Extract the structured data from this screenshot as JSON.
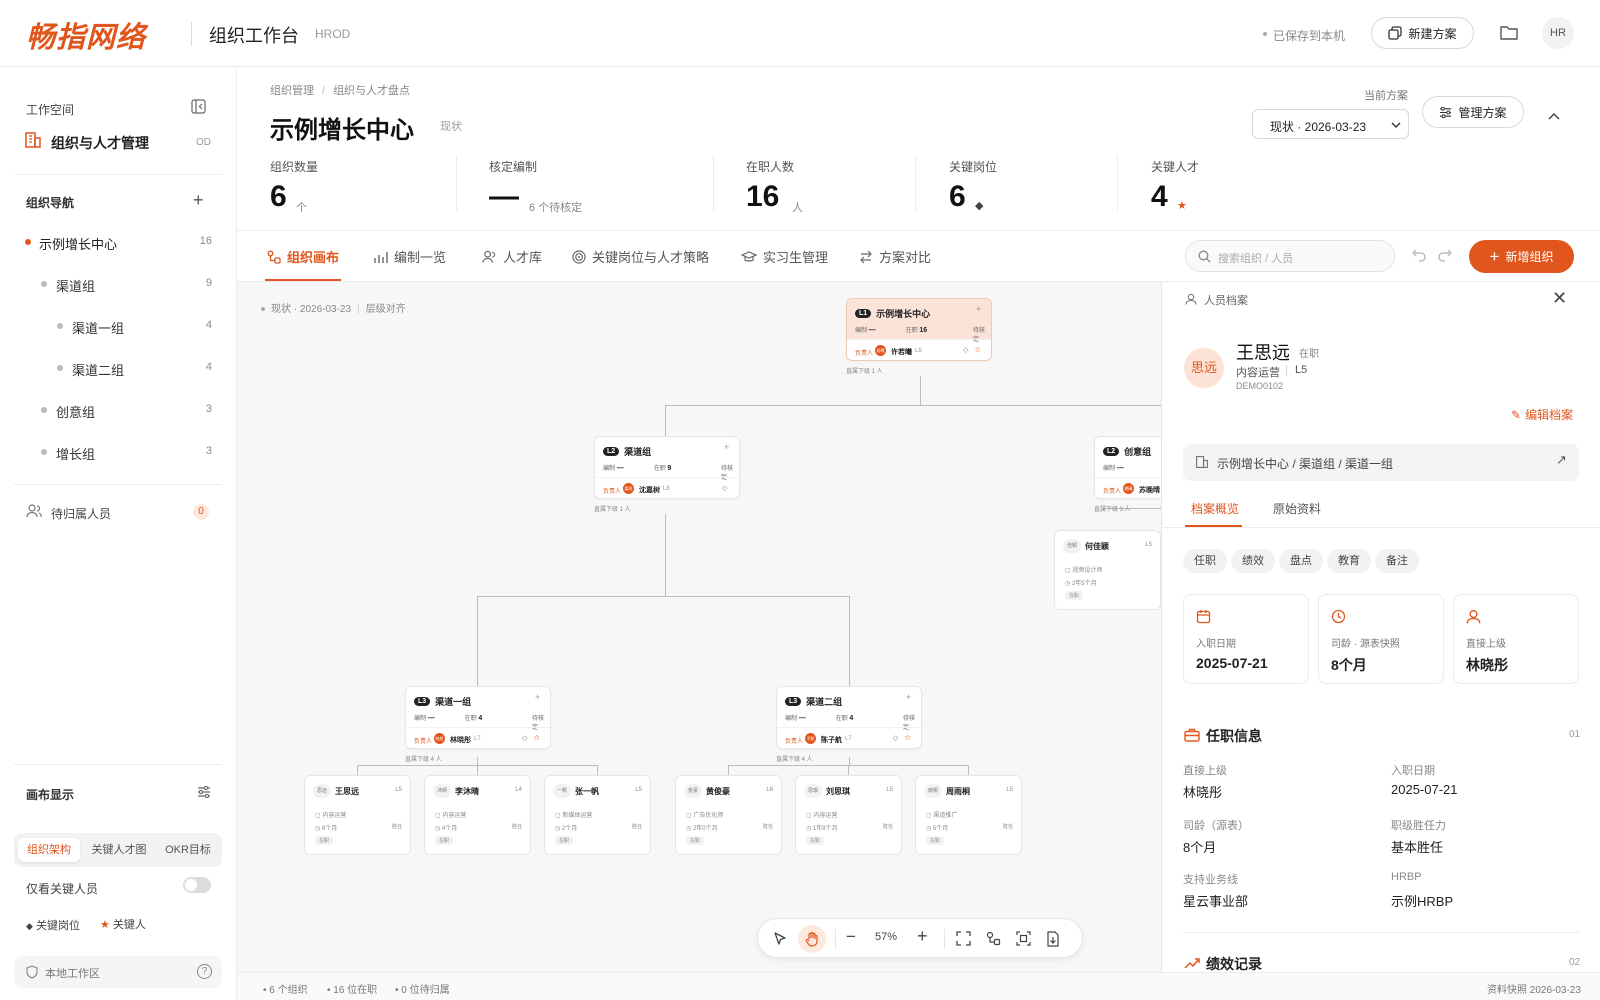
{
  "header": {
    "logo": "畅指网络",
    "title": "组织工作台",
    "subtitle": "HROD",
    "saved": "已保存到本机",
    "new_plan": "新建方案",
    "avatar": "HR"
  },
  "sidebar": {
    "workspace_label": "工作空间",
    "workspace_name": "组织与人才管理",
    "workspace_code": "OD",
    "nav_label": "组织导航",
    "items": [
      {
        "label": "示例增长中心",
        "count": "16"
      },
      {
        "label": "渠道组",
        "count": "9"
      },
      {
        "label": "渠道一组",
        "count": "4"
      },
      {
        "label": "渠道二组",
        "count": "4"
      },
      {
        "label": "创意组",
        "count": "3"
      },
      {
        "label": "增长组",
        "count": "3"
      }
    ],
    "pending_label": "待归属人员",
    "pending_count": "0",
    "canvas_label": "画布显示",
    "segments": [
      "组织架构",
      "关键人才图",
      "OKR目标"
    ],
    "only_key": "仅看关键人员",
    "legend_pos": "关键岗位",
    "legend_talent": "关键人",
    "local": "本地工作区"
  },
  "main": {
    "breadcrumb": [
      "组织管理",
      "组织与人才盘点"
    ],
    "title": "示例增长中心",
    "title_tag": "现状",
    "current_plan_label": "当前方案",
    "plan_select": "现状 · 2026-03-23",
    "manage": "管理方案",
    "kpis": [
      {
        "label": "组织数量",
        "value": "6",
        "unit": "个"
      },
      {
        "label": "核定编制",
        "value": "—",
        "unit": "6 个待核定"
      },
      {
        "label": "在职人数",
        "value": "16",
        "unit": "人"
      },
      {
        "label": "关键岗位",
        "value": "6",
        "unit": "◆"
      },
      {
        "label": "关键人才",
        "value": "4",
        "unit": "★"
      }
    ],
    "tabs": [
      "组织画布",
      "编制一览",
      "人才库",
      "关键岗位与人才策略",
      "实习生管理",
      "方案对比"
    ],
    "search_placeholder": "搜索组织 / 人员",
    "add_org": "新增组织"
  },
  "canvas": {
    "info": "现状 · 2026-03-23",
    "align": "层级对齐",
    "zoom": "57%",
    "org_meta": {
      "hc": "编制",
      "dash": "—",
      "onjob": "在职",
      "pending": "待核定",
      "lead": "负责人",
      "direct_prefix": "直属下级"
    },
    "orgs": [
      {
        "level": "L1",
        "name": "示例增长中心",
        "count": "16",
        "leader": "许若曦",
        "lvl": "L8",
        "av": "若曦",
        "direct": "直属下级 1 人"
      },
      {
        "level": "L2",
        "name": "渠道组",
        "count": "9",
        "leader": "沈嘉树",
        "lvl": "L8",
        "av": "嘉树",
        "direct": "直属下级 1 人"
      },
      {
        "level": "L2",
        "name": "创意组",
        "count": "",
        "leader": "苏晚晴",
        "lvl": "",
        "av": "晚晴",
        "direct": "直属下级 3 人"
      },
      {
        "level": "L3",
        "name": "渠道一组",
        "count": "4",
        "leader": "林晓彤",
        "lvl": "L7",
        "av": "晓彤",
        "direct": "直属下级 4 人"
      },
      {
        "level": "L3",
        "name": "渠道二组",
        "count": "4",
        "leader": "陈子航",
        "lvl": "L7",
        "av": "子航",
        "direct": "直属下级 4 人"
      }
    ],
    "people": [
      {
        "av": "佳颖",
        "name": "何佳颖",
        "lvl": "L5",
        "role": "视频设计师",
        "tenure": "2年5个月",
        "st": "在职"
      },
      {
        "av": "思远",
        "name": "王思远",
        "lvl": "L5",
        "role": "内容运营",
        "tenure": "8个月",
        "st": "在职"
      },
      {
        "av": "沐晴",
        "name": "李沐晴",
        "lvl": "L4",
        "role": "内容运营",
        "tenure": "4个月",
        "st": "在职"
      },
      {
        "av": "一帆",
        "name": "张一帆",
        "lvl": "L5",
        "role": "新媒体运营",
        "tenure": "2个月",
        "st": "在职"
      },
      {
        "av": "俊豪",
        "name": "黄俊豪",
        "lvl": "L6",
        "role": "广告优化师",
        "tenure": "2年0个月",
        "st": "在职"
      },
      {
        "av": "思琪",
        "name": "刘思琪",
        "lvl": "L5",
        "role": "内容运营",
        "tenure": "1年8个月",
        "st": "在职"
      },
      {
        "av": "雨桐",
        "name": "周雨桐",
        "lvl": "L5",
        "role": "渠道推广",
        "tenure": "5个月",
        "st": "在职"
      }
    ],
    "plan_tag": "胜任"
  },
  "status": {
    "orgs": "6 个组织",
    "onjob": "16 位在职",
    "pending": "0 位待归属",
    "snapshot": "资料快照 2026-03-23"
  },
  "panel": {
    "title": "人员档案",
    "avatar": "思远",
    "name": "王思远",
    "status": "在职",
    "role": "内容运营",
    "level": "L5",
    "id": "DEMO0102",
    "edit": "编辑档案",
    "path": "示例增长中心 / 渠道组 / 渠道一组",
    "tabs": [
      "档案概览",
      "原始资料"
    ],
    "chips": [
      "任职",
      "绩效",
      "盘点",
      "教育",
      "备注"
    ],
    "stats": [
      {
        "label": "入职日期",
        "value": "2025-07-21"
      },
      {
        "label": "司龄 · 源表快照",
        "value": "8个月"
      },
      {
        "label": "直接上级",
        "value": "林晓彤"
      }
    ],
    "section1": "任职信息",
    "section1_no": "01",
    "fields": [
      {
        "k": "直接上级",
        "v": "林晓彤"
      },
      {
        "k": "入职日期",
        "v": "2025-07-21"
      },
      {
        "k": "司龄（源表）",
        "v": "8个月"
      },
      {
        "k": "职级胜任力",
        "v": "基本胜任"
      },
      {
        "k": "支持业务线",
        "v": "星云事业部"
      },
      {
        "k": "HRBP",
        "v": "示例HRBP"
      }
    ],
    "section2": "绩效记录",
    "section2_no": "02"
  },
  "colors": {
    "accent": "#e0561c"
  }
}
